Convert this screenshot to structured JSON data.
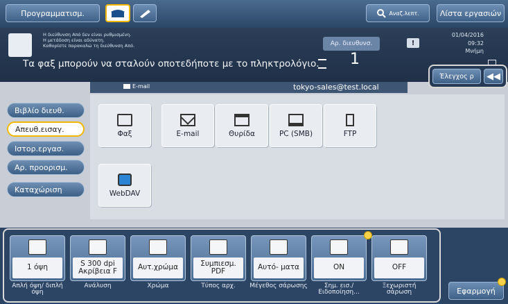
{
  "topbar": {
    "programming_label": "Προγραμματισμ.",
    "address_search_label": "Αναζ.λεπτ.",
    "job_list_label": "Λίστα εργασιών"
  },
  "message": {
    "line1": "Η διεύθυνση Από δεν είναι ρυθμισμένη.",
    "line2": "Η μετάδοση είναι αδύνατη.",
    "line3": "Καθορίστε παρακαλώ τη διεύθυνση Από.",
    "main": "Τα φαξ μπορούν να σταλούν οποτεδήποτε με το πληκτρολόγιο.",
    "dest_count_label": "Αρ. διευθυνσ.",
    "dest_count": "1",
    "date": "01/04/2016",
    "time": "09:32",
    "memory_label": "Μνήμη"
  },
  "check": {
    "check_label": "Έλεγχος ρ"
  },
  "destination": {
    "type_label": "E-mail",
    "address": "tokyo-sales@test.local"
  },
  "sidebar": {
    "items": [
      {
        "label": "Βιβλίο διευθ."
      },
      {
        "label": "Απευθ.εισαγ."
      },
      {
        "label": "Ιστορ.εργασ."
      },
      {
        "label": "Αρ. προορισμ."
      },
      {
        "label": "Καταχώριση"
      }
    ]
  },
  "tiles": [
    {
      "label": "Φαξ"
    },
    {
      "label": "E-mail"
    },
    {
      "label": "Θυρίδα"
    },
    {
      "label": "PC (SMB)"
    },
    {
      "label": "FTP"
    },
    {
      "label": "WebDAV"
    }
  ],
  "settings": [
    {
      "value": "1 όψη",
      "caption": "Απλή όψη/ διπλή όψη"
    },
    {
      "value": "S 300 dpi Ακρίβεια F",
      "caption": "Ανάλυση"
    },
    {
      "value": "Αυτ.χρώμα",
      "caption": "Χρώμα"
    },
    {
      "value": "Συμπιεσμ. PDF",
      "caption": "Τύπος αρχ."
    },
    {
      "value": "Αυτό- ματα",
      "caption": "Μέγεθος σάρωσης"
    },
    {
      "value": "ON",
      "caption": "Σημ. εισ./ Ειδοποίηση..."
    },
    {
      "value": "OFF",
      "caption": "Ξεχωριστή σάρωση"
    }
  ],
  "apply_label": "Εφαρμογή"
}
